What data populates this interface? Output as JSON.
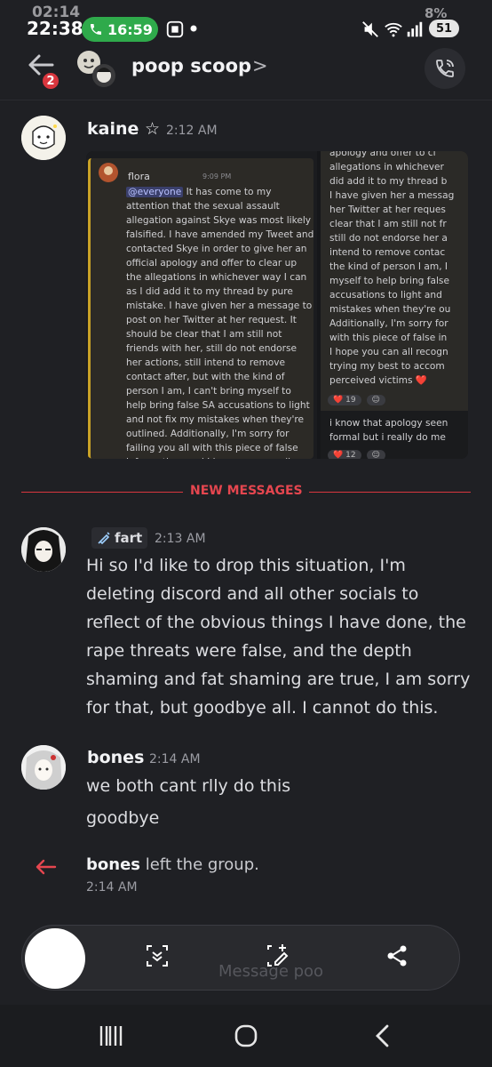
{
  "status_bar": {
    "ghost_time": "02:14",
    "time": "22:38",
    "call_duration": "16:59",
    "ghost_battery": "8%",
    "battery": "51"
  },
  "header": {
    "back_badge": "2",
    "group_name": "poop scoop",
    "chevron": ">"
  },
  "messages": [
    {
      "username": "kaine ☆",
      "time": "2:12 AM",
      "embed": {
        "name": "flora",
        "time": "9:09 PM",
        "mention": "@everyone",
        "text": " It has come to my attention that the sexual assault allegation against Skye was most likely falsified. I have amended my Tweet and contacted Skye in order to give her an official apology and offer to clear up the allegations in whichever way I can as I did add it to my thread by pure mistake. I have given her a message to post on her Twitter at her request. It should be clear that I am still not friends with her, still do not endorse her actions, still intend to remove contact after, but with the kind of person I am, I can't bring myself to help bring false SA accusations to light and not fix my mistakes when they're outlined. Additionally, I'm sorry for failing you all with this piece of false information, and I hope you can all recognise I was simply",
        "right_lines": [
          "apology and offer to cl",
          "allegations in whichever",
          "did add it to my thread b",
          "I have given her a messag",
          "her Twitter at her reques",
          "clear that I am still not fr",
          "still do not endorse her a",
          "intend to remove contac",
          "the kind of person I am, I",
          "myself to help bring false",
          "accusations to light and",
          "mistakes when they're ou",
          "Additionally, I'm sorry for",
          "with this piece of false in",
          "I hope you can all recogn",
          "trying my best to accom",
          "perceived victims ❤️"
        ],
        "reaction1": "19",
        "reply_lines": [
          "i know that apology seen",
          "formal but i really do me"
        ],
        "reaction2": "12"
      }
    }
  ],
  "new_messages_label": "NEW MESSAGES",
  "msg_fart": {
    "username": "fart",
    "time": "2:13 AM",
    "lines": [
      "Hi so I'd like to drop this situation, I'm",
      "deleting discord and all other socials to",
      "reflect of the obvious things I have done, the",
      "rape threats were false, and the depth",
      "shaming and fat shaming are true, I am sorry",
      "for that, but goodbye all. I cannot do this."
    ]
  },
  "msg_bones": {
    "username": "bones",
    "time": "2:14 AM",
    "lines": [
      "we both cant rlly do this",
      "goodbye"
    ]
  },
  "system": {
    "username": "bones",
    "text": " left the group.",
    "time": "2:14 AM"
  },
  "input_placeholder": "Message poo",
  "colors": {
    "background": "#1f2024",
    "accent_red": "#d9363e",
    "call_green": "#2faa4b"
  }
}
